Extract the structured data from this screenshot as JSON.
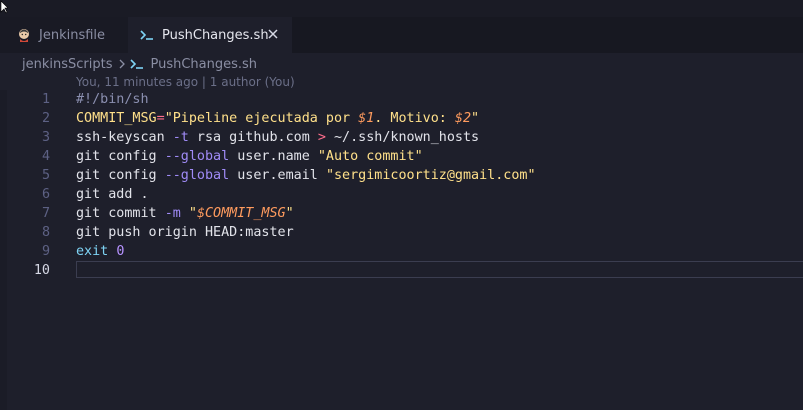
{
  "tabs": [
    {
      "label": "Jenkinsfile",
      "icon": "jenkins-icon",
      "active": false
    },
    {
      "label": "PushChanges.sh",
      "icon": "terminal-icon",
      "active": true
    }
  ],
  "breadcrumb": {
    "folder": "jenkinsScripts",
    "file": "PushChanges.sh"
  },
  "blame": "You, 11 minutes ago | 1 author (You)",
  "lines": [
    {
      "n": "1",
      "tokens": [
        {
          "t": "#!/bin/sh",
          "c": "t-comment"
        }
      ]
    },
    {
      "n": "2",
      "tokens": [
        {
          "t": "COMMIT_MSG",
          "c": "t-var"
        },
        {
          "t": "=",
          "c": "t-op"
        },
        {
          "t": "\"Pipeline ejecutada por ",
          "c": "t-str"
        },
        {
          "t": "$1",
          "c": "t-interp"
        },
        {
          "t": ". Motivo: ",
          "c": "t-str"
        },
        {
          "t": "$2",
          "c": "t-interp"
        },
        {
          "t": "\"",
          "c": "t-str"
        }
      ]
    },
    {
      "n": "3",
      "tokens": [
        {
          "t": "ssh-keyscan ",
          "c": "t-cmd"
        },
        {
          "t": "-t",
          "c": "t-flag"
        },
        {
          "t": " rsa github.com ",
          "c": "t-cmd"
        },
        {
          "t": ">",
          "c": "t-op"
        },
        {
          "t": " ~/.ssh/known_hosts",
          "c": "t-cmd"
        }
      ]
    },
    {
      "n": "4",
      "tokens": [
        {
          "t": "git config ",
          "c": "t-cmd"
        },
        {
          "t": "--global",
          "c": "t-flag"
        },
        {
          "t": " user.name ",
          "c": "t-cmd"
        },
        {
          "t": "\"Auto commit\"",
          "c": "t-str"
        }
      ]
    },
    {
      "n": "5",
      "tokens": [
        {
          "t": "git config ",
          "c": "t-cmd"
        },
        {
          "t": "--global",
          "c": "t-flag"
        },
        {
          "t": " user.email ",
          "c": "t-cmd"
        },
        {
          "t": "\"sergimicoortiz@gmail.com\"",
          "c": "t-str"
        }
      ]
    },
    {
      "n": "6",
      "tokens": [
        {
          "t": "git add .",
          "c": "t-cmd"
        }
      ]
    },
    {
      "n": "7",
      "tokens": [
        {
          "t": "git commit ",
          "c": "t-cmd"
        },
        {
          "t": "-m",
          "c": "t-flag"
        },
        {
          "t": " \"",
          "c": "t-str"
        },
        {
          "t": "$COMMIT_MSG",
          "c": "t-interp"
        },
        {
          "t": "\"",
          "c": "t-str"
        }
      ]
    },
    {
      "n": "8",
      "tokens": [
        {
          "t": "git push origin HEAD:master",
          "c": "t-cmd"
        }
      ]
    },
    {
      "n": "9",
      "tokens": [
        {
          "t": "exit",
          "c": "t-exit"
        },
        {
          "t": " ",
          "c": "t-cmd"
        },
        {
          "t": "0",
          "c": "t-num"
        }
      ]
    },
    {
      "n": "10",
      "tokens": [],
      "current": true
    }
  ]
}
